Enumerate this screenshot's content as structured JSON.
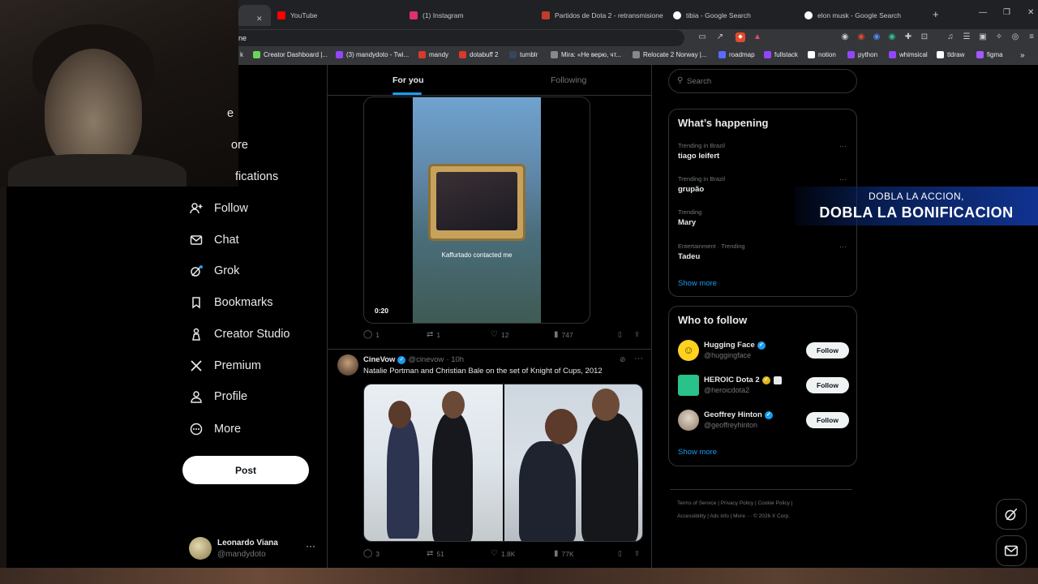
{
  "browser": {
    "tabs": [
      {
        "label": "YouTube",
        "color": "#ff0000"
      },
      {
        "label": "(1) Instagram",
        "color": "#e1306c"
      },
      {
        "label": "Partidos de Dota 2 - retransmisione",
        "color": "#c23c2a"
      },
      {
        "label": "tibia - Google Search",
        "color": "#4285f4"
      },
      {
        "label": "elon musk - Google Search",
        "color": "#4285f4"
      }
    ],
    "address_fragment": "ne",
    "bookmarks": [
      {
        "label": "k",
        "color": "#1d9bf0"
      },
      {
        "label": "Creator Dashboard |...",
        "color": "#6bd35b"
      },
      {
        "label": "(3) mandydoto - Twi...",
        "color": "#9146ff"
      },
      {
        "label": "mandy",
        "color": "#d93a2b"
      },
      {
        "label": "dotabuff 2",
        "color": "#d93a2b"
      },
      {
        "label": "tumblr",
        "color": "#36465d"
      },
      {
        "label": "Mira: «Не верю, чт...",
        "color": "#888888"
      },
      {
        "label": "Relocate 2 Norway |...",
        "color": "#888888"
      },
      {
        "label": "roadmap",
        "color": "#5a6bff"
      },
      {
        "label": "fullstack",
        "color": "#9146ff"
      },
      {
        "label": "notion",
        "color": "#ffffff"
      },
      {
        "label": "python",
        "color": "#9146ff"
      },
      {
        "label": "whimsical",
        "color": "#9146ff"
      },
      {
        "label": "tldraw",
        "color": "#ffffff"
      },
      {
        "label": "figma",
        "color": "#a259ff"
      }
    ]
  },
  "nav": {
    "partial_items": [
      "e",
      "ore",
      "fications"
    ],
    "items": [
      {
        "label": "Follow",
        "icon": "follow-icon"
      },
      {
        "label": "Chat",
        "icon": "chat-icon"
      },
      {
        "label": "Grok",
        "icon": "grok-icon"
      },
      {
        "label": "Bookmarks",
        "icon": "bookmark-icon"
      },
      {
        "label": "Creator Studio",
        "icon": "creator-studio-icon"
      },
      {
        "label": "Premium",
        "icon": "x-logo-icon"
      },
      {
        "label": "Profile",
        "icon": "profile-icon"
      },
      {
        "label": "More",
        "icon": "more-icon"
      }
    ],
    "post_label": "Post",
    "account": {
      "name": "Leonardo Viana",
      "handle": "@mandydoto"
    }
  },
  "timeline": {
    "tabs": [
      "For you",
      "Following"
    ],
    "tweet1": {
      "video_caption": "Kaffurtado contacted me",
      "video_time": "0:20",
      "replies": "1",
      "reposts": "1",
      "likes": "12",
      "views": "747"
    },
    "tweet2": {
      "author": "CineVow",
      "handle": "@cinevow",
      "time": "· 10h",
      "text": "Natalie Portman and Christian Bale on the set of Knight of Cups, 2012",
      "replies": "3",
      "reposts": "51",
      "likes": "1.8K",
      "views": "77K"
    }
  },
  "right": {
    "search_placeholder": "Search",
    "happening_title": "What’s happening",
    "trends": [
      {
        "context": "Trending in Brazil",
        "name": "tiago leifert"
      },
      {
        "context": "Trending in Brazil",
        "name": "grupão"
      },
      {
        "context": "Trending",
        "name": "Mary"
      },
      {
        "context": "Entertainment · Trending",
        "name": "Tadeu"
      }
    ],
    "show_more": "Show more",
    "wtf_title": "Who to follow",
    "wtf": [
      {
        "name": "Hugging Face",
        "handle": "@huggingface",
        "badge": "blue",
        "avatar_color": "#ffd21e"
      },
      {
        "name": "HEROIC Dota 2",
        "handle": "@heroicdota2",
        "badge": "gold",
        "avatar_color": "#28c28a"
      },
      {
        "name": "Geoffrey Hinton",
        "handle": "@geoffreyhinton",
        "badge": "blue",
        "avatar_color": "#c8b8a8"
      }
    ],
    "follow_label": "Follow",
    "footer_line1": "Terms of Service  |   Privacy Policy  |   Cookie Policy  |",
    "footer_line2": "Accessibility  |   Ads info  |   More ···   © 2026 X Corp."
  },
  "overlay": {
    "line1": "DOBLA LA ACCION,",
    "line2": "DOBLA LA BONIFICACION"
  }
}
